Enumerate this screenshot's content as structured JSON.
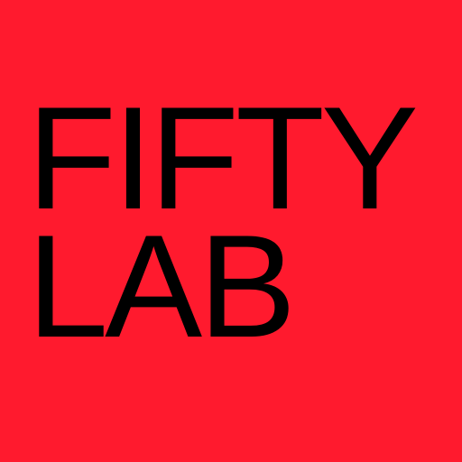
{
  "logo": {
    "line1": "FIFTY",
    "line2": "LAB"
  },
  "colors": {
    "background": "#ff1a2e",
    "text": "#000000"
  }
}
